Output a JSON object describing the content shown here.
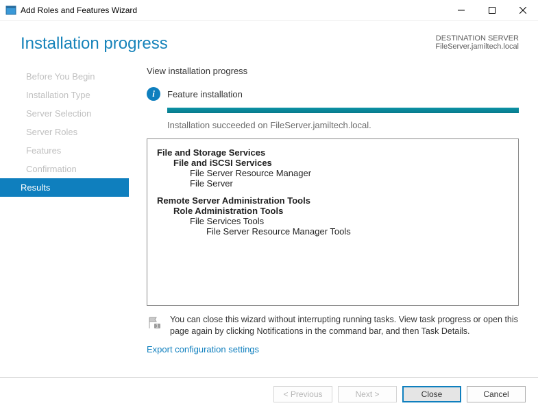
{
  "window": {
    "title": "Add Roles and Features Wizard"
  },
  "header": {
    "title": "Installation progress",
    "destLabel": "DESTINATION SERVER",
    "destServer": "FileServer.jamiltech.local"
  },
  "sidebar": {
    "items": [
      {
        "label": "Before You Begin"
      },
      {
        "label": "Installation Type"
      },
      {
        "label": "Server Selection"
      },
      {
        "label": "Server Roles"
      },
      {
        "label": "Features"
      },
      {
        "label": "Confirmation"
      },
      {
        "label": "Results"
      }
    ]
  },
  "content": {
    "subheader": "View installation progress",
    "statusTitle": "Feature installation",
    "statusMessage": "Installation succeeded on FileServer.jamiltech.local.",
    "tree": {
      "g1": {
        "n0": "File and Storage Services",
        "n1": "File and iSCSI Services",
        "n2a": "File Server Resource Manager",
        "n2b": "File Server"
      },
      "g2": {
        "n0": "Remote Server Administration Tools",
        "n1": "Role Administration Tools",
        "n2": "File Services Tools",
        "n3": "File Server Resource Manager Tools"
      }
    },
    "note": "You can close this wizard without interrupting running tasks. View task progress or open this page again by clicking Notifications in the command bar, and then Task Details.",
    "exportLink": "Export configuration settings"
  },
  "footer": {
    "previous": "< Previous",
    "next": "Next >",
    "close": "Close",
    "cancel": "Cancel"
  }
}
